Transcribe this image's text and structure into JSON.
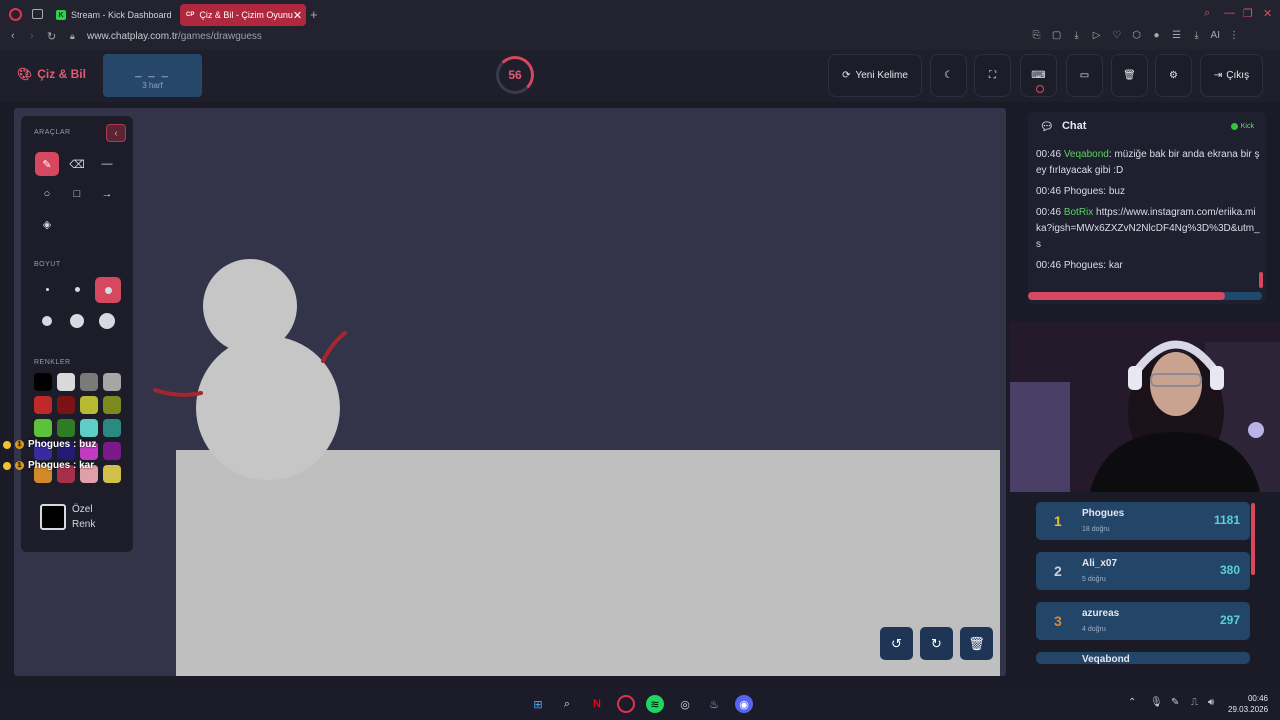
{
  "browser": {
    "tabs": [
      {
        "label": "Stream - Kick Dashboard",
        "favicon": "K"
      },
      {
        "label": "Çiz & Bil - Çizim Oyunu",
        "favicon": "CP"
      }
    ],
    "new_tab": "+",
    "url_host": "www.chatplay.com.tr",
    "url_path": "/games/drawguess",
    "ai_label": "AI"
  },
  "header": {
    "brand": "Çiz & Bil",
    "word_mask": "_ _ _",
    "word_hint": "3 harf",
    "timer": "56",
    "new_word": "Yeni Kelime",
    "logout": "Çıkış"
  },
  "tools": {
    "label": "ARAÇLAR",
    "size_label": "BOYUT",
    "colors_label": "RENKLER",
    "custom_color": "Özel Renk",
    "swatches": [
      "#000000",
      "#d9d9d9",
      "#7a7a7a",
      "#a6a6a6",
      "#c0282a",
      "#7a1216",
      "#b8ba34",
      "#7c8a1e",
      "#5bc23a",
      "#2e7d26",
      "#5ecdc6",
      "#2a8a82",
      "#3a2a9e",
      "#241a74",
      "#c23ac2",
      "#7a1a8a",
      "#d08a2a",
      "#a6304a",
      "#e0a0a8",
      "#d0c04a"
    ]
  },
  "guesses": [
    {
      "text": "Phogues : buz",
      "count": "1"
    },
    {
      "text": "Phogues : kar",
      "count": "1"
    }
  ],
  "chat": {
    "title": "Chat",
    "platform": "Kick",
    "messages": [
      {
        "time": "00:46",
        "user": "Veqabond",
        "sep": ":",
        "text": "müziğe bak bir anda ekrana bir şey fırlayacak gibi :D",
        "highlight": true
      },
      {
        "time": "00:46",
        "user": "Phogues",
        "sep": ":",
        "text": "buz",
        "highlight": false
      },
      {
        "time": "00:46",
        "user": "BotRix",
        "sep": "",
        "text": "https://www.instagram.com/eriika.mika?igsh=MWx6ZXZvN2NlcDF4Ng%3D%3D&utm_s",
        "highlight": true
      },
      {
        "time": "00:46",
        "user": "Phogues",
        "sep": ":",
        "text": "kar",
        "highlight": false
      }
    ],
    "progress": 0.84
  },
  "leaderboard": [
    {
      "rank": "1",
      "name": "Phogues",
      "sub": "18 doğru",
      "score": "1181",
      "rank_color": "#e9c02f"
    },
    {
      "rank": "2",
      "name": "Ali_x07",
      "sub": "5 doğru",
      "score": "380",
      "rank_color": "#c8d0dc"
    },
    {
      "rank": "3",
      "name": "azureas",
      "sub": "4 doğru",
      "score": "297",
      "rank_color": "#d9893a"
    },
    {
      "rank": "",
      "name": "Veqabond",
      "sub": "",
      "score": "",
      "rank_color": "#c8d0dc"
    }
  ],
  "taskbar": {
    "time": "00:46",
    "date": "29.03.2026"
  },
  "colors": {
    "accent": "#d6485f",
    "panel": "#1c1d28",
    "canvas": "#33334a",
    "ground": "#bfbfbf"
  }
}
